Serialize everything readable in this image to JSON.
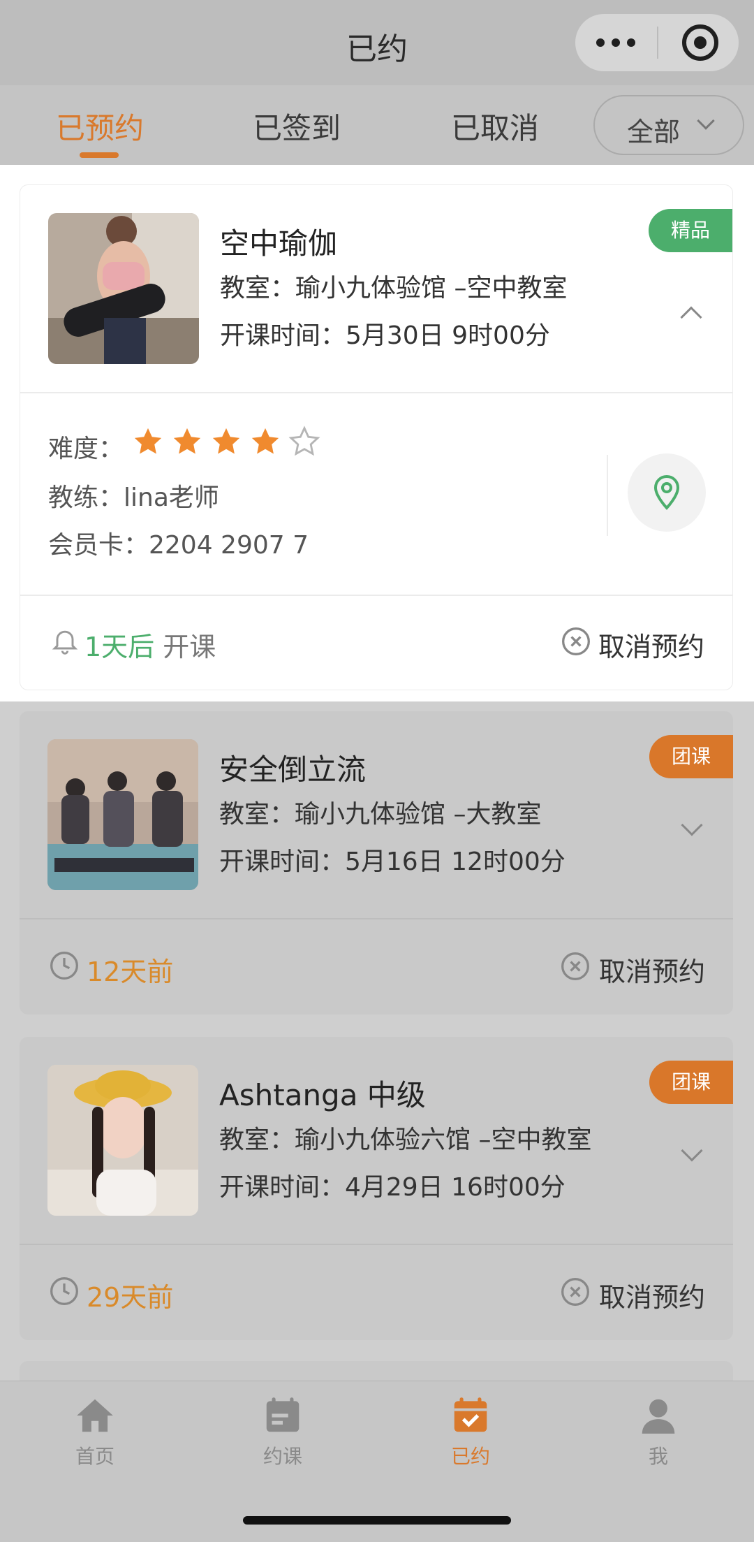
{
  "header": {
    "title": "已约"
  },
  "tabs": [
    {
      "label": "已预约",
      "active": true
    },
    {
      "label": "已签到",
      "active": false
    },
    {
      "label": "已取消",
      "active": false
    }
  ],
  "filter": {
    "label": "全部"
  },
  "cards": [
    {
      "name": "空中瑜伽",
      "room": "教室：瑜小九体验馆 –空中教室",
      "time": "开课时间：5月30日 9时00分",
      "badge": "精品",
      "expanded": true,
      "details": {
        "difficulty_label": "难度：",
        "difficulty_rating": 4,
        "difficulty_max": 5,
        "coach": "教练：lina老师",
        "member_card": "会员卡：2204 2907 7"
      },
      "status_highlight": "1天后",
      "status_rest": "开课",
      "cancel_label": "取消预约"
    },
    {
      "name": "安全倒立流",
      "room": "教室：瑜小九体验馆 –大教室",
      "time": "开课时间：5月16日 12时00分",
      "badge": "团课",
      "expanded": false,
      "status_highlight": "12天前",
      "cancel_label": "取消预约"
    },
    {
      "name": "Ashtanga 中级",
      "room": "教室：瑜小九体验六馆 –空中教室",
      "time": "开课时间：4月29日 16时00分",
      "badge": "团课",
      "expanded": false,
      "status_highlight": "29天前",
      "cancel_label": "取消预约"
    }
  ],
  "bottom_nav": [
    {
      "label": "首页",
      "icon": "home-icon",
      "active": false
    },
    {
      "label": "约课",
      "icon": "calendar-icon",
      "active": false
    },
    {
      "label": "已约",
      "icon": "calendar-check-icon",
      "active": true
    },
    {
      "label": "我",
      "icon": "user-icon",
      "active": false
    }
  ],
  "colors": {
    "accent": "#d9792c",
    "green": "#4cae6c",
    "star": "#f08a2e"
  }
}
